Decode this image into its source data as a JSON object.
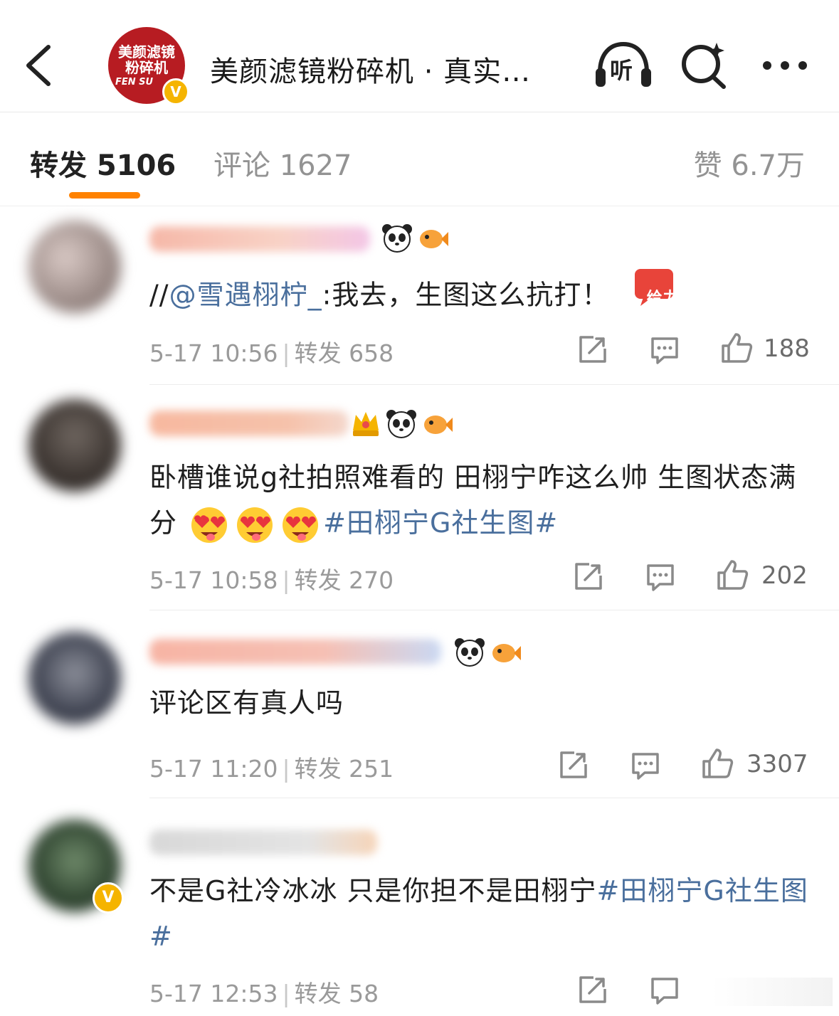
{
  "header": {
    "avatar_text_line1": "美颜滤镜",
    "avatar_text_line2": "粉碎机",
    "avatar_text_line3": "FEN SU",
    "verified_mark": "V",
    "title": "美颜滤镜粉碎机 · 真实…",
    "listen_label": "听",
    "icons": [
      "back-arrow-icon",
      "headphones-listen-icon",
      "search-sparkle-icon",
      "more-dots-icon"
    ]
  },
  "tabs": {
    "repost": "转发 5106",
    "comment": "评论 1627",
    "like": "赞 6.7万"
  },
  "accent_color": "#ff8200",
  "link_color": "#4a6f9d",
  "posts": [
    {
      "content_prefix": "//",
      "mention": "@雪遇栩柠_",
      "content_rest": ":我去，生图这么抗打！",
      "badge_text": "给力",
      "time": "5-17 10:56",
      "repost_label": "转发 658",
      "likes": "188"
    },
    {
      "content": "卧槽谁说g社拍照难看的 田栩宁咋这么帅 生图状态满分",
      "hashtag": "#田栩宁G社生图#",
      "time": "5-17 10:58",
      "repost_label": "转发 270",
      "likes": "202"
    },
    {
      "content": "评论区有真人吗",
      "time": "5-17 11:20",
      "repost_label": "转发 251",
      "likes": "3307"
    },
    {
      "content": "不是G社冷冰冰 只是你担不是田栩宁",
      "hashtag": "#田栩宁G社生图#",
      "verified_mark": "V",
      "time": "5-17 12:53",
      "repost_label": "转发 58"
    }
  ]
}
